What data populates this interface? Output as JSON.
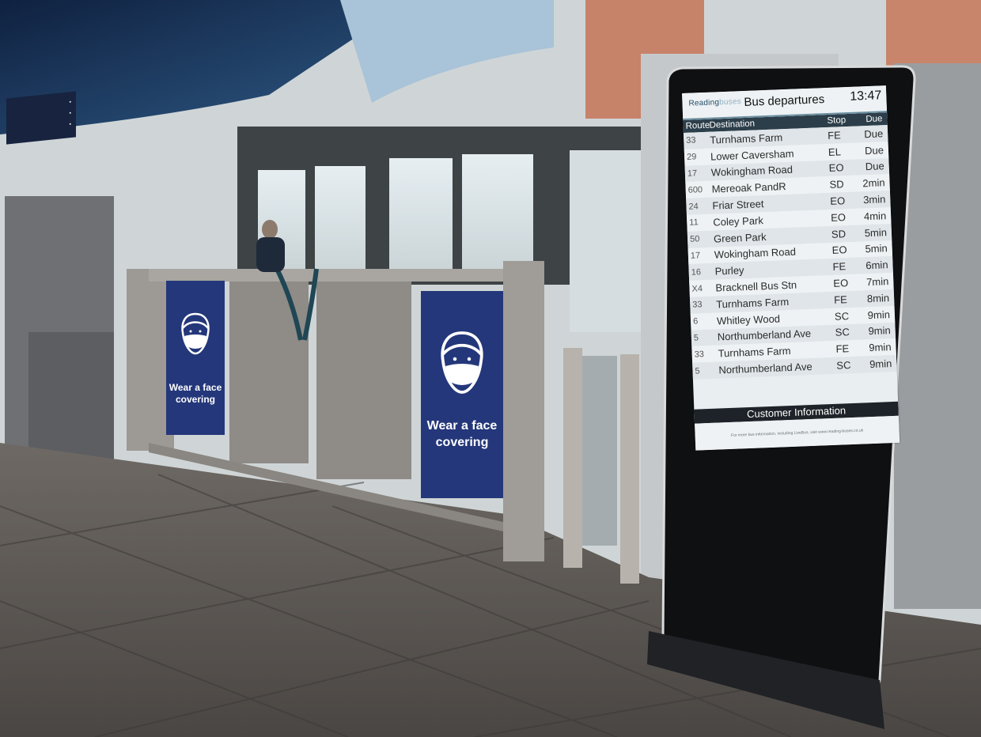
{
  "board": {
    "logo_part1": "Reading",
    "logo_part2": "buses",
    "title": "Bus departures",
    "time": "13:47",
    "columns": {
      "route": "Route",
      "destination": "Destination",
      "stop": "Stop",
      "due": "Due"
    },
    "departures": [
      {
        "route": "33",
        "destination": "Turnhams Farm",
        "stop": "FE",
        "due": "Due"
      },
      {
        "route": "29",
        "destination": "Lower Caversham",
        "stop": "EL",
        "due": "Due"
      },
      {
        "route": "17",
        "destination": "Wokingham Road",
        "stop": "EO",
        "due": "Due"
      },
      {
        "route": "600",
        "destination": "Mereoak PandR",
        "stop": "SD",
        "due": "2min"
      },
      {
        "route": "24",
        "destination": "Friar Street",
        "stop": "EO",
        "due": "3min"
      },
      {
        "route": "11",
        "destination": "Coley Park",
        "stop": "EO",
        "due": "4min"
      },
      {
        "route": "50",
        "destination": "Green Park",
        "stop": "SD",
        "due": "5min"
      },
      {
        "route": "17",
        "destination": "Wokingham Road",
        "stop": "EO",
        "due": "5min"
      },
      {
        "route": "16",
        "destination": "Purley",
        "stop": "FE",
        "due": "6min"
      },
      {
        "route": "X4",
        "destination": "Bracknell Bus Stn",
        "stop": "EO",
        "due": "7min"
      },
      {
        "route": "33",
        "destination": "Turnhams Farm",
        "stop": "FE",
        "due": "8min"
      },
      {
        "route": "6",
        "destination": "Whitley Wood",
        "stop": "SC",
        "due": "9min"
      },
      {
        "route": "5",
        "destination": "Northumberland Ave",
        "stop": "SC",
        "due": "9min"
      },
      {
        "route": "33",
        "destination": "Turnhams Farm",
        "stop": "FE",
        "due": "9min"
      },
      {
        "route": "5",
        "destination": "Northumberland Ave",
        "stop": "SC",
        "due": "9min"
      }
    ],
    "info_bar": "Customer Information",
    "info_footer": "For more bus information, including LiveBus, visit www.reading-buses.co.uk"
  },
  "posters": [
    {
      "line1": "Wear a face",
      "line2": "covering"
    },
    {
      "line1": "Wear a face",
      "line2": "covering"
    }
  ],
  "colors": {
    "poster_blue": "#24377a",
    "floor": "#5a5652",
    "totem": "#0f1012"
  }
}
